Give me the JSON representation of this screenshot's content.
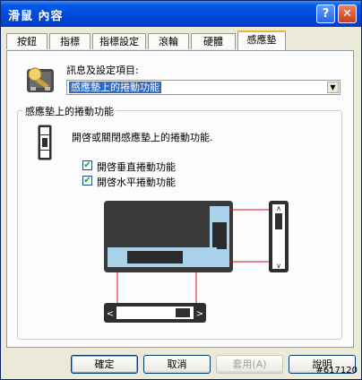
{
  "window": {
    "title": "滑鼠 內容",
    "help_glyph": "?",
    "close_glyph": "✕"
  },
  "tabs": [
    {
      "label": "按鈕"
    },
    {
      "label": "指標"
    },
    {
      "label": "指標設定"
    },
    {
      "label": "滾輪"
    },
    {
      "label": "硬體"
    },
    {
      "label": "感應墊"
    }
  ],
  "settings": {
    "label": "訊息及設定項目:",
    "selected": "感應墊上的捲動功能",
    "dropdown_glyph": "▼"
  },
  "group": {
    "title": "感應墊上的捲動功能",
    "description": "開啓或關閉感應墊上的捲動功能.",
    "vertical_label": "開啓垂直捲動功能",
    "vertical_checked": true,
    "horizontal_label": "開啓水平捲動功能",
    "horizontal_checked": true,
    "check_glyph": "✔"
  },
  "scroll_glyphs": {
    "up": "∧",
    "down": "∨",
    "left": "<",
    "right": ">"
  },
  "buttons": {
    "ok": "確定",
    "cancel": "取消",
    "apply": "套用(A)",
    "help": "說明"
  },
  "watermark": "#617120"
}
